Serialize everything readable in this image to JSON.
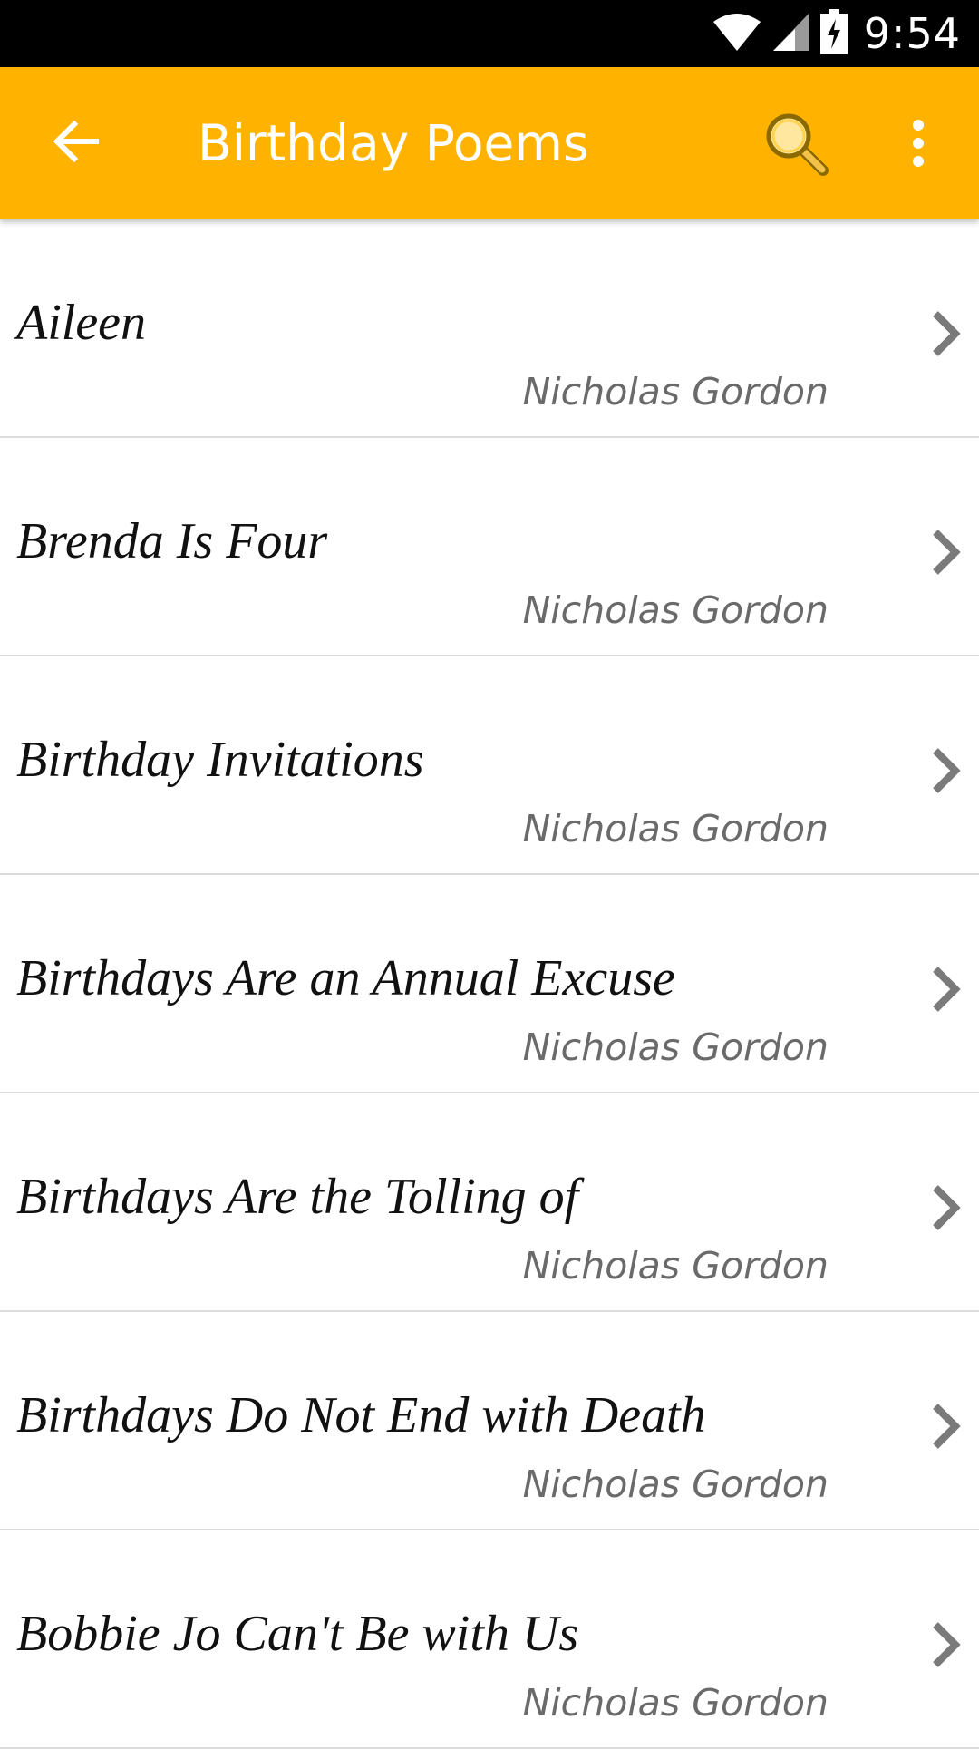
{
  "status_bar": {
    "time": "9:54",
    "icons": [
      "wifi-icon",
      "cell-signal-icon",
      "battery-charging-icon"
    ]
  },
  "app_bar": {
    "title": "Birthday Poems",
    "back_icon": "arrow-left-icon",
    "search_icon": "search-icon",
    "overflow_icon": "more-vert-icon"
  },
  "colors": {
    "app_bar": "#ffb300",
    "status_bar": "#000000",
    "title_text": "#111111",
    "author_text": "#6a6a6a",
    "divider": "#dcdcdc",
    "chevron": "#7a7a7a"
  },
  "poems": [
    {
      "title": "Aileen",
      "author": "Nicholas Gordon"
    },
    {
      "title": "Brenda Is Four",
      "author": "Nicholas Gordon"
    },
    {
      "title": "Birthday Invitations",
      "author": "Nicholas Gordon"
    },
    {
      "title": "Birthdays Are an Annual Excuse",
      "author": "Nicholas Gordon"
    },
    {
      "title": "Birthdays Are the Tolling of",
      "author": "Nicholas Gordon"
    },
    {
      "title": "Birthdays Do Not End with Death",
      "author": "Nicholas Gordon"
    },
    {
      "title": "Bobbie Jo Can't Be with Us",
      "author": "Nicholas Gordon"
    }
  ]
}
